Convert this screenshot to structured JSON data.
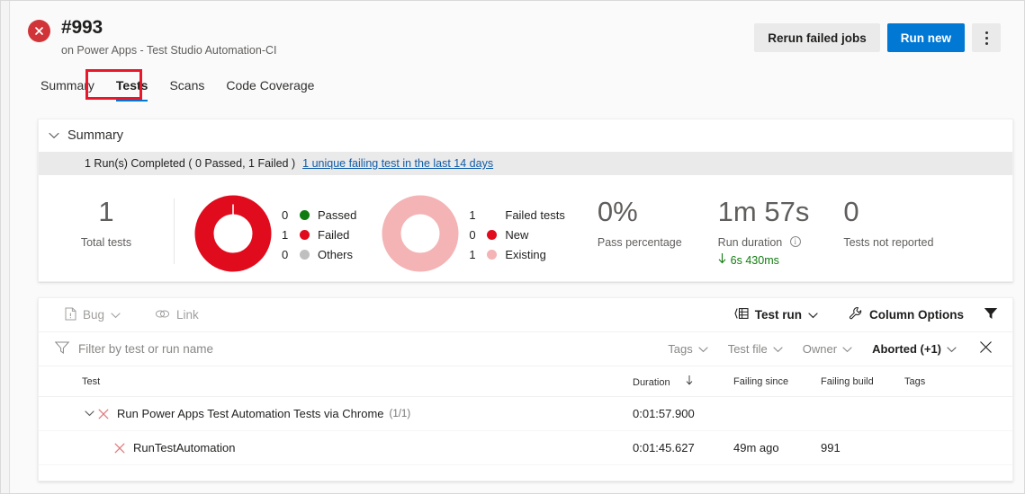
{
  "header": {
    "status_icon": "error-circle-icon",
    "build_id": "#993",
    "subtitle": "on Power Apps - Test Studio Automation-CI",
    "actions": {
      "rerun_label": "Rerun failed jobs",
      "run_new_label": "Run new",
      "more_label": "more-actions"
    }
  },
  "tabs": [
    {
      "label": "Summary",
      "active": false
    },
    {
      "label": "Tests",
      "active": true
    },
    {
      "label": "Scans",
      "active": false
    },
    {
      "label": "Code Coverage",
      "active": false
    }
  ],
  "annotation": {
    "target": "Tests",
    "color": "#e8182a"
  },
  "summary": {
    "section_label": "Summary",
    "run_strip": {
      "text": "1 Run(s) Completed ( 0 Passed, 1 Failed )",
      "link": "1 unique failing test in the last 14 days"
    },
    "total": {
      "value": "1",
      "label": "Total tests"
    },
    "outcome_donut": {
      "legend": [
        {
          "count": "0",
          "label": "Passed",
          "color": "#107c10"
        },
        {
          "count": "1",
          "label": "Failed",
          "color": "#e00b1c"
        },
        {
          "count": "0",
          "label": "Others",
          "color": "#bfbfbf"
        }
      ]
    },
    "failed_donut": {
      "legend": [
        {
          "count": "1",
          "label": "Failed tests",
          "color": ""
        },
        {
          "count": "0",
          "label": "New",
          "color": "#e00b1c"
        },
        {
          "count": "1",
          "label": "Existing",
          "color": "#f4b3b5"
        }
      ]
    },
    "pass_percentage": {
      "value": "0%",
      "label": "Pass percentage"
    },
    "run_duration": {
      "value": "1m 57s",
      "label": "Run duration",
      "delta": "6s 430ms",
      "delta_direction": "down",
      "delta_color": "#107c10"
    },
    "not_reported": {
      "value": "0",
      "label": "Tests not reported"
    }
  },
  "results": {
    "commandbar": {
      "bug_label": "Bug",
      "link_label": "Link",
      "testrun_label": "Test run",
      "column_options_label": "Column Options",
      "filter_icon": "filter-funnel-icon"
    },
    "filterbar": {
      "search_placeholder": "Filter by test or run name",
      "dropdowns": [
        {
          "label": "Tags",
          "active": false
        },
        {
          "label": "Test file",
          "active": false
        },
        {
          "label": "Owner",
          "active": false
        },
        {
          "label": "Aborted (+1)",
          "active": true
        }
      ],
      "clear_label": "×"
    },
    "columns": [
      "Test",
      "Duration",
      "Failing since",
      "Failing build",
      "Tags"
    ],
    "sorted_column": "Duration",
    "rows": [
      {
        "type": "group",
        "expanded": true,
        "status": "failed",
        "test": "Run Power Apps Test Automation Tests via Chrome",
        "sub_count": "(1/1)",
        "duration": "0:01:57.900",
        "failing_since": "",
        "failing_build": "",
        "tags": ""
      },
      {
        "type": "child",
        "status": "failed",
        "test": "RunTestAutomation",
        "sub_count": "",
        "duration": "0:01:45.627",
        "failing_since": "49m ago",
        "failing_build": "991",
        "tags": ""
      }
    ]
  },
  "colors": {
    "accent": "#0078d4",
    "error": "#d13438",
    "failed": "#e00b1c",
    "existing": "#f4b3b5",
    "passed": "#107c10",
    "annotation": "#e8182a"
  }
}
